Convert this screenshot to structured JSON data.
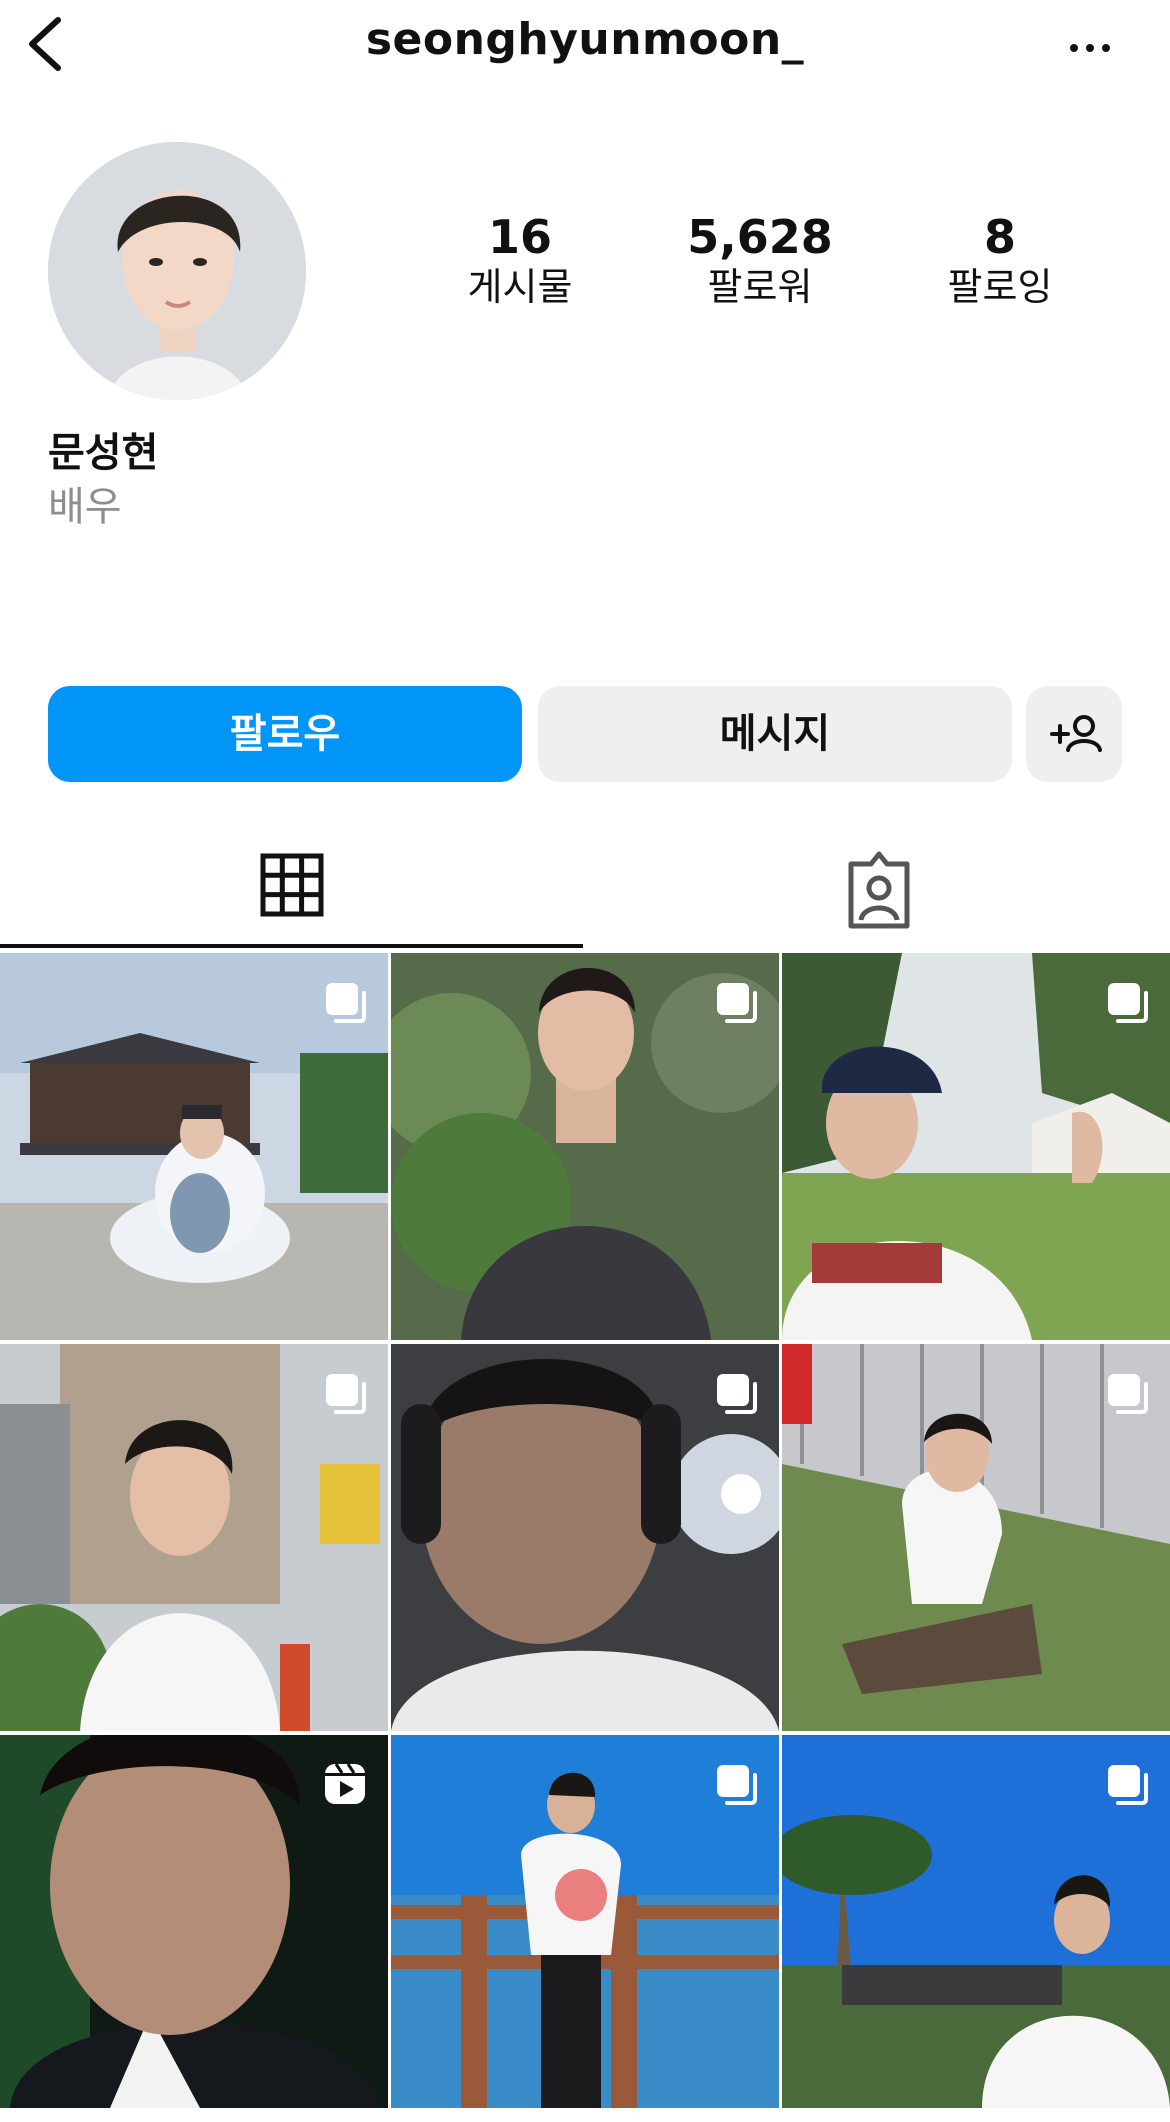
{
  "header": {
    "username": "seonghyunmoon_",
    "back_icon": "chevron-left-icon",
    "more_icon": "more-horizontal-icon"
  },
  "profile": {
    "name": "문성현",
    "bio": "배우",
    "stats": {
      "posts": {
        "value": "16",
        "label": "게시물"
      },
      "followers": {
        "value": "5,628",
        "label": "팔로워"
      },
      "following": {
        "value": "8",
        "label": "팔로잉"
      }
    }
  },
  "actions": {
    "follow_label": "팔로우",
    "message_label": "메시지",
    "add_friend_icon": "add-person-icon"
  },
  "tabs": [
    {
      "icon": "grid-icon",
      "active": true
    },
    {
      "icon": "tagged-person-icon",
      "active": false
    }
  ],
  "colors": {
    "accent": "#0095f6",
    "secondary_button": "#efefef",
    "muted_text": "#8e8e8e"
  },
  "grid": [
    {
      "badge": "carousel-icon"
    },
    {
      "badge": "carousel-icon"
    },
    {
      "badge": "carousel-icon"
    },
    {
      "badge": "carousel-icon"
    },
    {
      "badge": "carousel-icon"
    },
    {
      "badge": "carousel-icon"
    },
    {
      "badge": "reels-icon"
    },
    {
      "badge": "carousel-icon"
    },
    {
      "badge": "carousel-icon"
    }
  ]
}
